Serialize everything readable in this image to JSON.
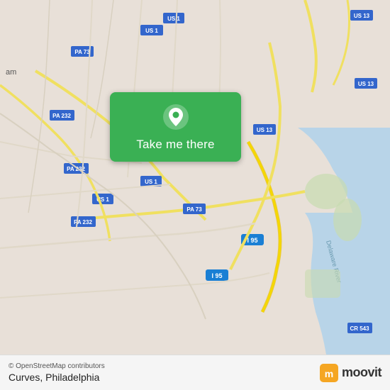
{
  "map": {
    "background_color": "#e8e0d8",
    "center_lat": 40.02,
    "center_lon": -75.07
  },
  "button": {
    "label": "Take me there",
    "icon": "location-pin-icon",
    "bg_color": "#3ab054"
  },
  "bottom_bar": {
    "osm_credit": "© OpenStreetMap contributors",
    "location_name": "Curves, Philadelphia",
    "moovit_label": "moovit"
  },
  "road_labels": [
    "US 1",
    "US 13",
    "PA 73",
    "PA 232",
    "I 95",
    "Delaware River",
    "CR 543"
  ]
}
